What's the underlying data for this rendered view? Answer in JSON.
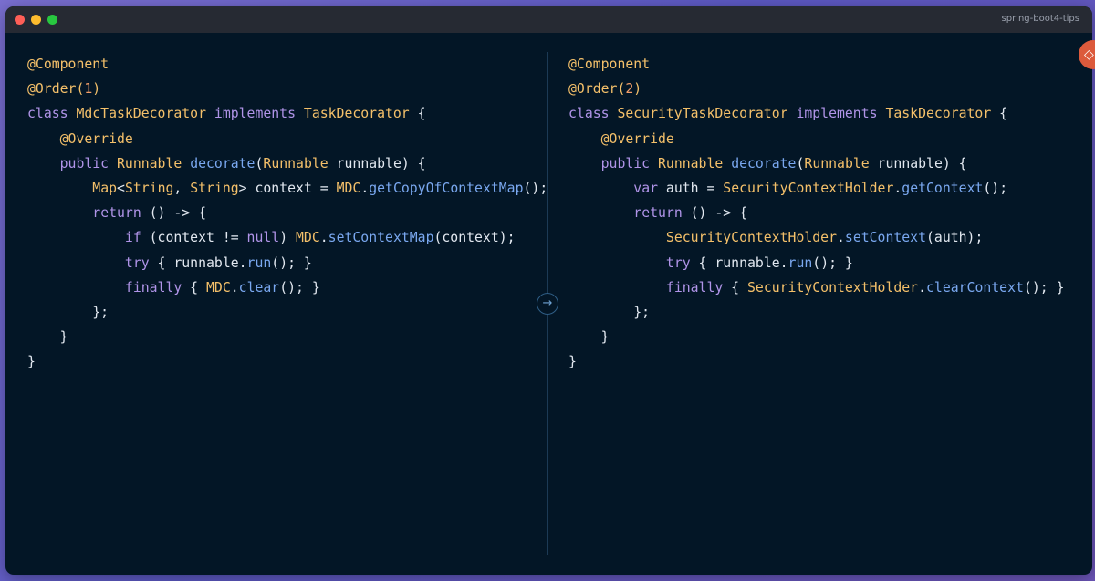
{
  "window": {
    "title": "spring-boot4-tips",
    "controls": [
      "close",
      "minimize",
      "zoom"
    ]
  },
  "colors": {
    "annotation": "#f4c06a",
    "keyword": "#b094e8",
    "type": "#f4c06a",
    "method": "#7aa8f0",
    "number": "#f6a06a",
    "text": "#e2e8f0",
    "background": "#031626",
    "badge": "#dc5a3c"
  },
  "divider": {
    "arrow_icon": "arrow-right-icon",
    "arrow_glyph": "→"
  },
  "side_badge": {
    "icon": "git-diff-icon",
    "glyph": "◇"
  },
  "panes": [
    {
      "lines": [
        [
          {
            "t": "annot",
            "v": "@Component"
          }
        ],
        [
          {
            "t": "annot",
            "v": "@Order("
          },
          {
            "t": "num",
            "v": "1"
          },
          {
            "t": "annot",
            "v": ")"
          }
        ],
        [
          {
            "t": "kw",
            "v": "class "
          },
          {
            "t": "type",
            "v": "MdcTaskDecorator"
          },
          {
            "t": "kw",
            "v": " implements "
          },
          {
            "t": "type",
            "v": "TaskDecorator"
          },
          {
            "t": "plain",
            "v": " {"
          }
        ],
        [
          {
            "t": "plain",
            "v": "    "
          },
          {
            "t": "annot",
            "v": "@Override"
          }
        ],
        [
          {
            "t": "plain",
            "v": "    "
          },
          {
            "t": "kw",
            "v": "public "
          },
          {
            "t": "type",
            "v": "Runnable"
          },
          {
            "t": "plain",
            "v": " "
          },
          {
            "t": "method",
            "v": "decorate"
          },
          {
            "t": "plain",
            "v": "("
          },
          {
            "t": "type",
            "v": "Runnable"
          },
          {
            "t": "plain",
            "v": " runnable) {"
          }
        ],
        [
          {
            "t": "plain",
            "v": "        "
          },
          {
            "t": "type",
            "v": "Map"
          },
          {
            "t": "plain",
            "v": "<"
          },
          {
            "t": "type",
            "v": "String"
          },
          {
            "t": "plain",
            "v": ", "
          },
          {
            "t": "type",
            "v": "String"
          },
          {
            "t": "plain",
            "v": "> context = "
          },
          {
            "t": "type",
            "v": "MDC"
          },
          {
            "t": "plain",
            "v": "."
          },
          {
            "t": "method",
            "v": "getCopyOfContextMap"
          },
          {
            "t": "plain",
            "v": "();"
          }
        ],
        [
          {
            "t": "plain",
            "v": "        "
          },
          {
            "t": "kw",
            "v": "return"
          },
          {
            "t": "plain",
            "v": " () -> {"
          }
        ],
        [
          {
            "t": "plain",
            "v": "            "
          },
          {
            "t": "kw",
            "v": "if"
          },
          {
            "t": "plain",
            "v": " (context != "
          },
          {
            "t": "kw",
            "v": "null"
          },
          {
            "t": "plain",
            "v": ") "
          },
          {
            "t": "type",
            "v": "MDC"
          },
          {
            "t": "plain",
            "v": "."
          },
          {
            "t": "method",
            "v": "setContextMap"
          },
          {
            "t": "plain",
            "v": "(context);"
          }
        ],
        [
          {
            "t": "plain",
            "v": "            "
          },
          {
            "t": "kw",
            "v": "try"
          },
          {
            "t": "plain",
            "v": " { runnable."
          },
          {
            "t": "method",
            "v": "run"
          },
          {
            "t": "plain",
            "v": "(); }"
          }
        ],
        [
          {
            "t": "plain",
            "v": "            "
          },
          {
            "t": "kw",
            "v": "finally"
          },
          {
            "t": "plain",
            "v": " { "
          },
          {
            "t": "type",
            "v": "MDC"
          },
          {
            "t": "plain",
            "v": "."
          },
          {
            "t": "method",
            "v": "clear"
          },
          {
            "t": "plain",
            "v": "(); }"
          }
        ],
        [
          {
            "t": "plain",
            "v": "        };"
          }
        ],
        [
          {
            "t": "plain",
            "v": "    }"
          }
        ],
        [
          {
            "t": "plain",
            "v": "}"
          }
        ]
      ]
    },
    {
      "lines": [
        [
          {
            "t": "annot",
            "v": "@Component"
          }
        ],
        [
          {
            "t": "annot",
            "v": "@Order("
          },
          {
            "t": "num",
            "v": "2"
          },
          {
            "t": "annot",
            "v": ")"
          }
        ],
        [
          {
            "t": "kw",
            "v": "class "
          },
          {
            "t": "type",
            "v": "SecurityTaskDecorator"
          },
          {
            "t": "kw",
            "v": " implements "
          },
          {
            "t": "type",
            "v": "TaskDecorator"
          },
          {
            "t": "plain",
            "v": " {"
          }
        ],
        [
          {
            "t": "plain",
            "v": "    "
          },
          {
            "t": "annot",
            "v": "@Override"
          }
        ],
        [
          {
            "t": "plain",
            "v": "    "
          },
          {
            "t": "kw",
            "v": "public "
          },
          {
            "t": "type",
            "v": "Runnable"
          },
          {
            "t": "plain",
            "v": " "
          },
          {
            "t": "method",
            "v": "decorate"
          },
          {
            "t": "plain",
            "v": "("
          },
          {
            "t": "type",
            "v": "Runnable"
          },
          {
            "t": "plain",
            "v": " runnable) {"
          }
        ],
        [
          {
            "t": "plain",
            "v": "        "
          },
          {
            "t": "kw",
            "v": "var"
          },
          {
            "t": "plain",
            "v": " auth = "
          },
          {
            "t": "type",
            "v": "SecurityContextHolder"
          },
          {
            "t": "plain",
            "v": "."
          },
          {
            "t": "method",
            "v": "getContext"
          },
          {
            "t": "plain",
            "v": "();"
          }
        ],
        [
          {
            "t": "plain",
            "v": "        "
          },
          {
            "t": "kw",
            "v": "return"
          },
          {
            "t": "plain",
            "v": " () -> {"
          }
        ],
        [
          {
            "t": "plain",
            "v": "            "
          },
          {
            "t": "type",
            "v": "SecurityContextHolder"
          },
          {
            "t": "plain",
            "v": "."
          },
          {
            "t": "method",
            "v": "setContext"
          },
          {
            "t": "plain",
            "v": "(auth);"
          }
        ],
        [
          {
            "t": "plain",
            "v": "            "
          },
          {
            "t": "kw",
            "v": "try"
          },
          {
            "t": "plain",
            "v": " { runnable."
          },
          {
            "t": "method",
            "v": "run"
          },
          {
            "t": "plain",
            "v": "(); }"
          }
        ],
        [
          {
            "t": "plain",
            "v": "            "
          },
          {
            "t": "kw",
            "v": "finally"
          },
          {
            "t": "plain",
            "v": " { "
          },
          {
            "t": "type",
            "v": "SecurityContextHolder"
          },
          {
            "t": "plain",
            "v": "."
          },
          {
            "t": "method",
            "v": "clearContext"
          },
          {
            "t": "plain",
            "v": "(); }"
          }
        ],
        [
          {
            "t": "plain",
            "v": "        };"
          }
        ],
        [
          {
            "t": "plain",
            "v": "    }"
          }
        ],
        [
          {
            "t": "plain",
            "v": "}"
          }
        ]
      ]
    }
  ]
}
